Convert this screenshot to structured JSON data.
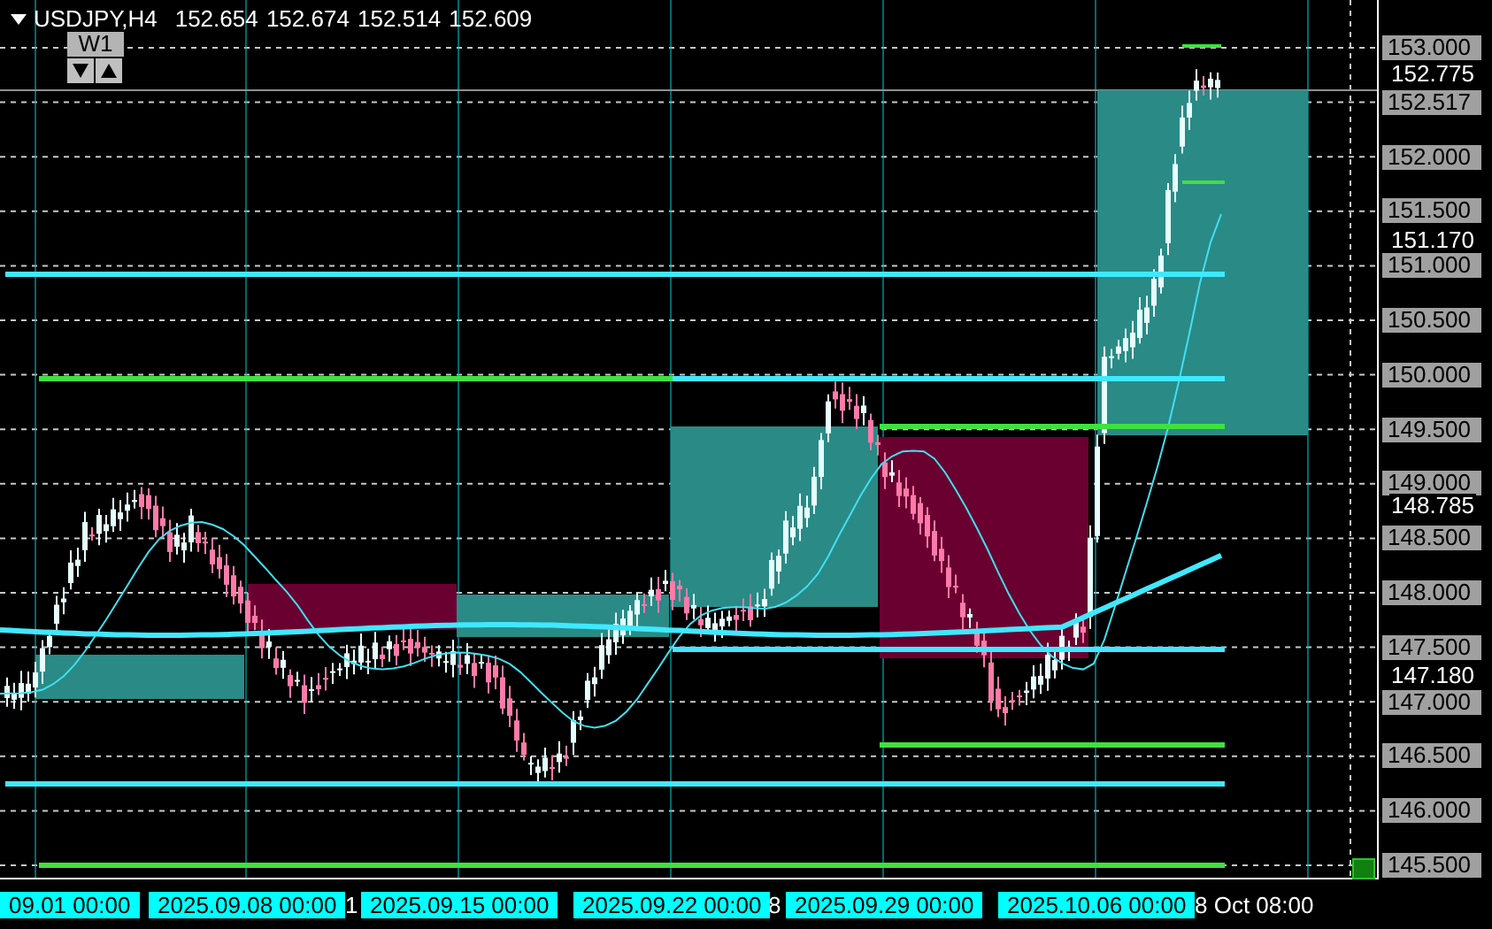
{
  "header": {
    "symbol": "USDJPY,H4",
    "quote": "152.654 152.674 152.514 152.609"
  },
  "timeframe_button": {
    "label": "W1"
  },
  "price_axis": {
    "labels": [
      "153.000",
      "152.517",
      "152.000",
      "151.500",
      "151.000",
      "150.500",
      "150.000",
      "149.500",
      "149.000",
      "148.500",
      "148.000",
      "147.500",
      "147.000",
      "146.500",
      "146.000",
      "145.500"
    ],
    "markers": [
      "152.775",
      "151.170",
      "148.785",
      "147.180"
    ]
  },
  "time_axis": {
    "labels": [
      {
        "text": "09.01 00:00",
        "kind": "highlight"
      },
      {
        "text": "2025.09.08 00:00",
        "kind": "highlight"
      },
      {
        "text": "1",
        "kind": "plain"
      },
      {
        "text": "2025.09.15 00:00",
        "kind": "highlight"
      },
      {
        "text": "2025.09.22 00:00",
        "kind": "highlight"
      },
      {
        "text": "8",
        "kind": "plain"
      },
      {
        "text": "2025.09.29 00:00",
        "kind": "highlight"
      },
      {
        "text": "2025.10.06 00:00",
        "kind": "highlight"
      },
      {
        "text": "8 Oct 08:00",
        "kind": "plain"
      }
    ]
  }
}
